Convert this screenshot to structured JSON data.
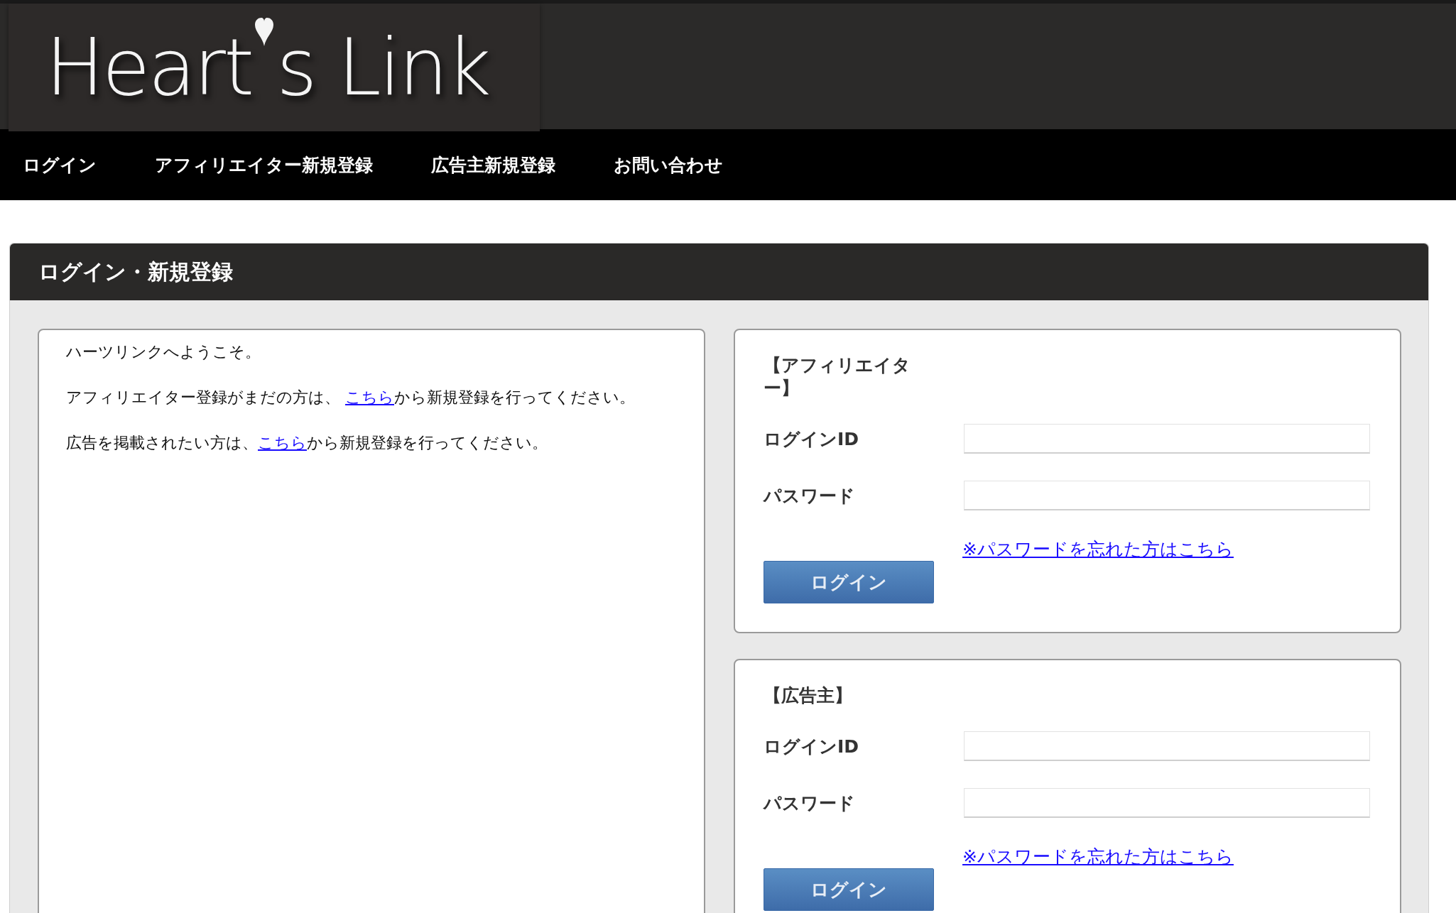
{
  "logo": {
    "before": "Heart",
    "after": "s Link"
  },
  "nav": [
    {
      "label": "ログイン"
    },
    {
      "label": "アフィリエイター新規登録"
    },
    {
      "label": "広告主新規登録"
    },
    {
      "label": "お問い合わせ"
    }
  ],
  "panel": {
    "title": "ログイン・新規登録",
    "intro": [
      {
        "before": "ハーツリンクへようこそ。"
      },
      {
        "before": "アフィリエイター登録がまだの方は、 ",
        "link": "こちら",
        "after": "から新規登録を行ってください。"
      },
      {
        "before": "広告を掲載されたい方は、",
        "link": "こちら",
        "after": "から新規登録を行ってください。"
      }
    ],
    "forms": [
      {
        "heading": "【アフィリエイター】",
        "fields": [
          {
            "label": "ログインID"
          },
          {
            "label": "パスワード"
          }
        ],
        "forgot_link": "※パスワードを忘れた方はこちら",
        "button": "ログイン"
      },
      {
        "heading": "【広告主】",
        "fields": [
          {
            "label": "ログインID"
          },
          {
            "label": "パスワード"
          }
        ],
        "forgot_link": "※パスワードを忘れた方はこちら",
        "button": "ログイン"
      }
    ]
  }
}
